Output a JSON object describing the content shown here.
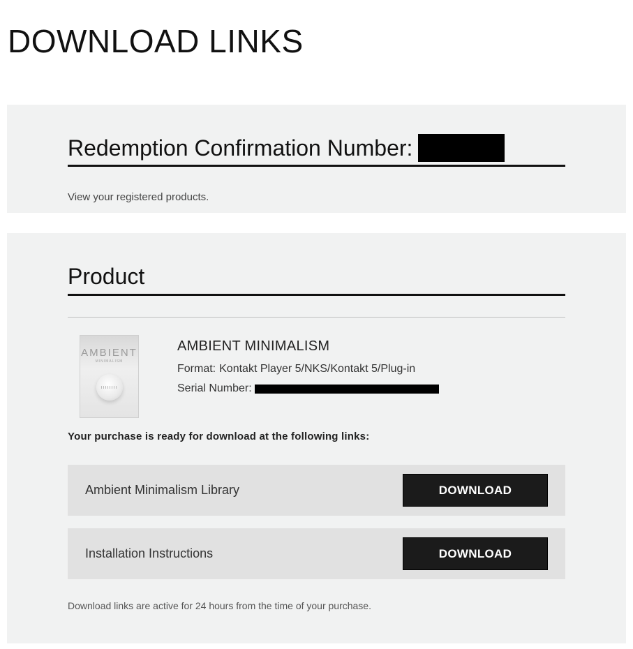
{
  "page": {
    "title": "DOWNLOAD LINKS"
  },
  "confirmation": {
    "heading": "Redemption Confirmation Number:",
    "link_text": "View your registered products."
  },
  "product_section": {
    "heading": "Product",
    "product": {
      "name": "AMBIENT MINIMALISM",
      "format_label": "Format:",
      "format_value": "Kontakt Player 5/NKS/Kontakt 5/Plug-in",
      "serial_label": "Serial Number:",
      "cover": {
        "title": "AMBIENT",
        "subtitle": "MINIMALISM"
      }
    },
    "ready_text": "Your purchase is ready for download at the following links:",
    "downloads": [
      {
        "label": "Ambient Minimalism Library",
        "button": "DOWNLOAD"
      },
      {
        "label": "Installation Instructions",
        "button": "DOWNLOAD"
      }
    ],
    "footnote": "Download links are active for 24 hours from the time of your purchase."
  }
}
